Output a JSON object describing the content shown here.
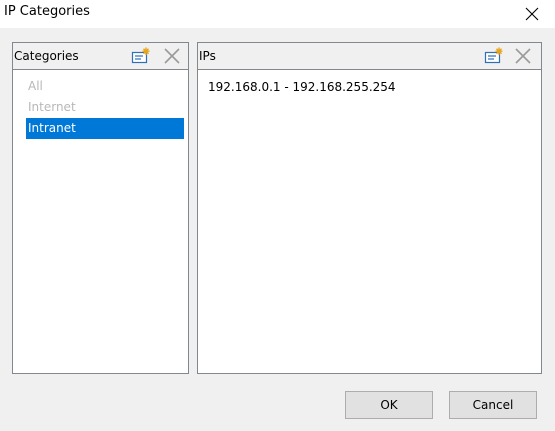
{
  "window": {
    "title": "IP Categories"
  },
  "categories_panel": {
    "label": "Categories",
    "items": [
      {
        "label": "All",
        "state": "disabled"
      },
      {
        "label": "Internet",
        "state": "disabled"
      },
      {
        "label": "Intranet",
        "state": "selected"
      }
    ]
  },
  "ips_panel": {
    "label": "IPs",
    "entries": [
      "192.168.0.1 - 192.168.255.254"
    ]
  },
  "buttons": {
    "ok": "OK",
    "cancel": "Cancel"
  },
  "colors": {
    "selection": "#0078d7",
    "disabled_text": "#b8b8b8",
    "border": "#828790"
  }
}
